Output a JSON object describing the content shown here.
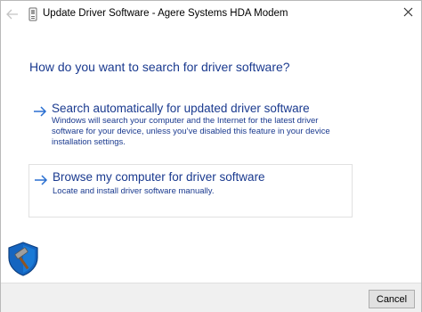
{
  "titlebar": {
    "title": "Update Driver Software - Agere Systems HDA Modem",
    "back_icon": "back-arrow-icon",
    "device_icon": "modem-device-icon",
    "close_icon": "close-icon"
  },
  "main": {
    "heading": "How do you want to search for driver software?",
    "options": [
      {
        "title": "Search automatically for updated driver software",
        "description": "Windows will search your computer and the Internet for the latest driver software for your device, unless you’ve disabled this feature in your device installation settings."
      },
      {
        "title": "Browse my computer for driver software",
        "description": "Locate and install driver software manually."
      }
    ]
  },
  "footer": {
    "cancel_label": "Cancel"
  },
  "colors": {
    "link_blue": "#1a3a8f",
    "arrow_blue": "#2a6fd1",
    "footer_bg": "#f0f0f0"
  }
}
